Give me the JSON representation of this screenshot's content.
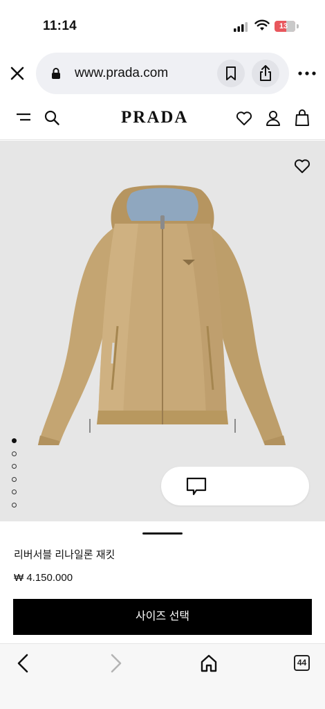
{
  "status_bar": {
    "time": "11:14",
    "battery_level": "13"
  },
  "browser": {
    "url": "www.prada.com",
    "tab_count": "44"
  },
  "site": {
    "brand": "PRADA"
  },
  "product": {
    "name": "리버서블 리나일론 재킷",
    "price": "₩ 4.150.000",
    "size_button_label": "사이즈 선택",
    "gallery_image_count": 6,
    "gallery_active_index": 0
  },
  "colors": {
    "jacket": "#c8a978",
    "hood_lining": "#8fa7bf",
    "gallery_background": "#e6e6e6",
    "battery_low": "#e8575d",
    "primary_button": "#000000"
  },
  "icons": {
    "status": [
      "signal-icon",
      "wifi-icon",
      "battery-icon"
    ],
    "url_bar": [
      "close-icon",
      "lock-icon",
      "bookmark-icon",
      "share-icon",
      "more-icon"
    ],
    "header": [
      "menu-icon",
      "search-icon",
      "heart-icon",
      "user-icon",
      "bag-icon"
    ],
    "gallery": [
      "wishlist-heart-icon",
      "chat-icon"
    ],
    "toolbar": [
      "back-arrow-icon",
      "forward-arrow-icon",
      "home-icon",
      "tabs-icon"
    ]
  }
}
